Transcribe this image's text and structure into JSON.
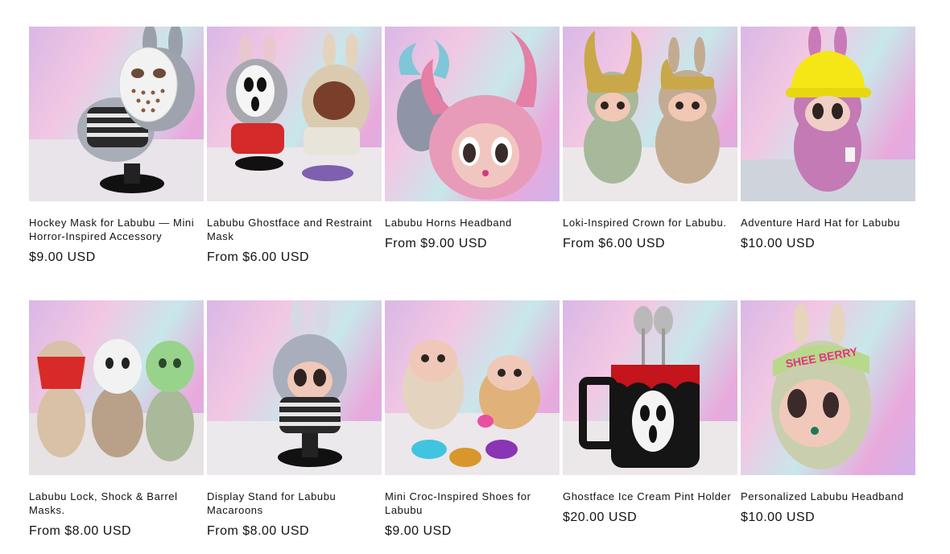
{
  "products": [
    {
      "title": "Hockey Mask for Labubu — Mini Horror-Inspired Accessory",
      "price": "$9.00 USD",
      "image": "hockey-mask"
    },
    {
      "title": "Labubu Ghostface and Restraint Mask",
      "price": "From $6.00 USD",
      "image": "ghostface-restraint"
    },
    {
      "title": "Labubu Horns Headband",
      "price": "From $9.00 USD",
      "image": "horns"
    },
    {
      "title": "Loki-Inspired Crown for Labubu.",
      "price": "From $6.00 USD",
      "image": "loki-crown"
    },
    {
      "title": "Adventure Hard Hat for Labubu",
      "price": "$10.00 USD",
      "image": "hard-hat"
    },
    {
      "title": "Labubu Lock, Shock & Barrel Masks.",
      "price": "From $8.00 USD",
      "image": "lock-shock-barrel"
    },
    {
      "title": "Display Stand for Labubu Macaroons",
      "price": "From $8.00 USD",
      "image": "display-stand"
    },
    {
      "title": "Mini Croc-Inspired Shoes for Labubu",
      "price": "$9.00 USD",
      "image": "croc-shoes"
    },
    {
      "title": "Ghostface Ice Cream Pint Holder",
      "price": "$20.00 USD",
      "image": "pint-holder"
    },
    {
      "title": "Personalized Labubu Headband",
      "price": "$10.00 USD",
      "image": "headband",
      "headband_text": "SHEE BERRY"
    }
  ]
}
